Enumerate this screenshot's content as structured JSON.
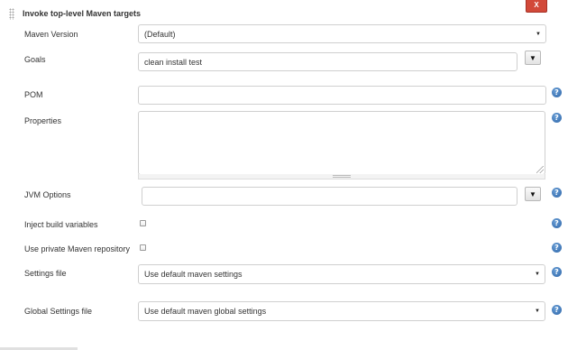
{
  "section": {
    "title": "Invoke top-level Maven targets",
    "close_label": "X"
  },
  "fields": {
    "maven_version": {
      "label": "Maven Version",
      "value": "(Default)"
    },
    "goals": {
      "label": "Goals",
      "value": "clean install test"
    },
    "pom": {
      "label": "POM",
      "value": ""
    },
    "properties": {
      "label": "Properties",
      "value": ""
    },
    "jvm_options": {
      "label": "JVM Options",
      "value": ""
    },
    "inject_build_variables": {
      "label": "Inject build variables",
      "checked": false
    },
    "use_private_repo": {
      "label": "Use private Maven repository",
      "checked": false
    },
    "settings_file": {
      "label": "Settings file",
      "value": "Use default maven settings"
    },
    "global_settings_file": {
      "label": "Global Settings file",
      "value": "Use default maven global settings"
    }
  },
  "icons": {
    "help": "?",
    "caret": "▼"
  },
  "colors": {
    "close_button": "#d24939",
    "help_icon": "#2d65a8",
    "field_border": "#cfcfcf"
  }
}
